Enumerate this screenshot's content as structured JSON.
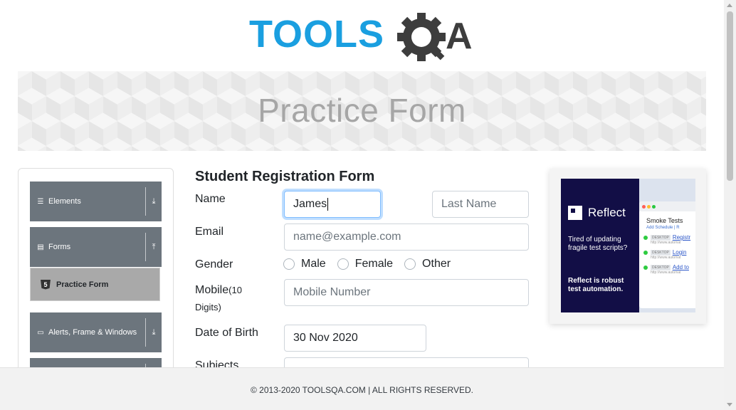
{
  "logo": {
    "text_primary": "TOOLS",
    "text_secondary": "QA",
    "color_primary": "#1a9fe0",
    "color_secondary": "#3d3d3d"
  },
  "banner": {
    "title": "Practice Form"
  },
  "sidebar": {
    "groups": [
      {
        "label": "Elements",
        "icon": "hamburger-icon",
        "arrow": "download-arrow-icon"
      },
      {
        "label": "Forms",
        "icon": "document-icon",
        "arrow": "upload-arrow-icon"
      },
      {
        "label": "Alerts, Frame & Windows",
        "icon": "window-icon",
        "arrow": "download-arrow-icon"
      }
    ],
    "active_item": {
      "label": "Practice Form",
      "icon": "html5-icon"
    }
  },
  "form": {
    "title": "Student Registration Form",
    "name_label": "Name",
    "first_name_value": "James",
    "last_name_placeholder": "Last Name",
    "email_label": "Email",
    "email_placeholder": "name@example.com",
    "gender_label": "Gender",
    "gender_options": [
      "Male",
      "Female",
      "Other"
    ],
    "mobile_label": "Mobile",
    "mobile_hint": "(10",
    "mobile_hint2": "Digits)",
    "mobile_placeholder": "Mobile Number",
    "dob_label": "Date of Birth",
    "dob_value": "30 Nov 2020",
    "subjects_label": "Subjects"
  },
  "ad": {
    "brand": "Reflect",
    "tagline": "Tired of updating fragile test scripts?",
    "cta": "Reflect is robust test automation.",
    "window_title": "Smoke Tests",
    "window_sub": "Add Schedule | R",
    "rows": [
      {
        "tag": "DESKTOP",
        "link": "Registr",
        "url": "http://www.automat"
      },
      {
        "tag": "DESKTOP",
        "link": "Login",
        "url": "http://www.automat"
      },
      {
        "tag": "DESKTOP",
        "link": "Add to",
        "url": "http://www.automat"
      }
    ]
  },
  "footer": {
    "text": "© 2013-2020 TOOLSQA.COM | ALL RIGHTS RESERVED."
  }
}
